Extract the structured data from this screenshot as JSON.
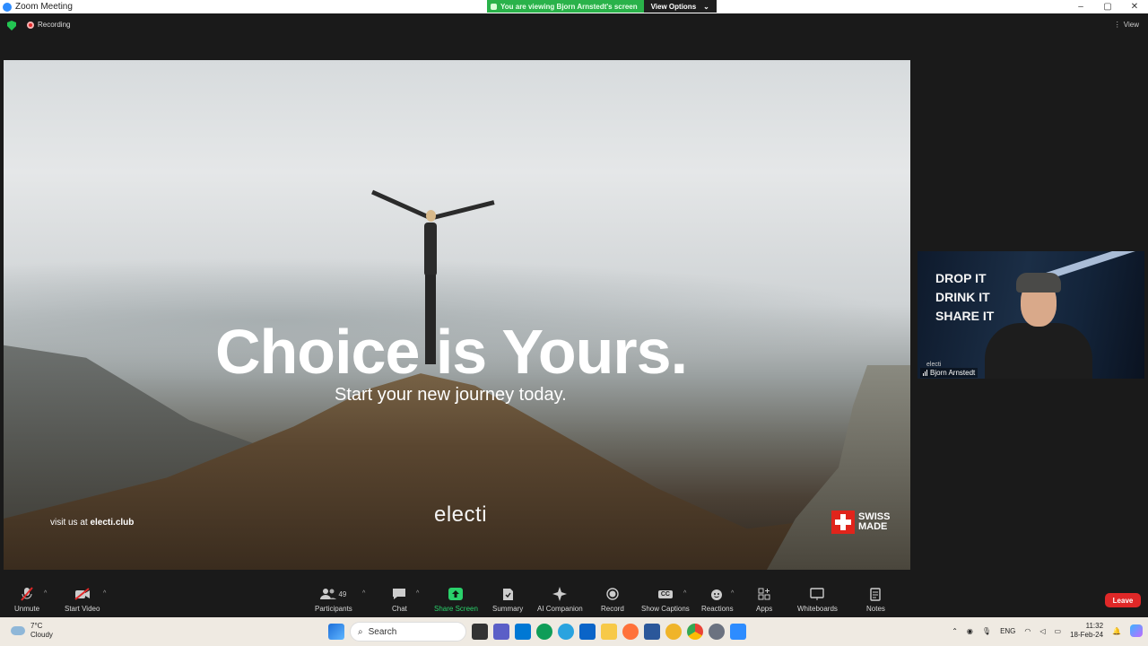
{
  "window": {
    "title": "Zoom Meeting",
    "controls": [
      "–",
      "▢",
      "✕"
    ]
  },
  "banner": {
    "viewing_text": "You are viewing Bjorn Arnstedt's screen",
    "view_options_label": "View Options",
    "view_options_caret": "⌄"
  },
  "status": {
    "recording_label": "Recording",
    "view_label": "View"
  },
  "shared_screen": {
    "headline": "Choice is Yours.",
    "subline": "Start your new journey today.",
    "visit_prefix": "visit us at ",
    "visit_link": "electi.club",
    "brand": "electi",
    "badge_line1": "SWISS",
    "badge_line2": "MADE"
  },
  "video_tile": {
    "slogan": [
      "DROP IT",
      "DRINK IT",
      "SHARE IT"
    ],
    "tag": "electi",
    "participant_name": "Bjorn Arnstedt"
  },
  "toolbar": {
    "unmute": "Unmute",
    "start_video": "Start Video",
    "participants": "Participants",
    "participants_count": "49",
    "chat": "Chat",
    "share_screen": "Share Screen",
    "summary": "Summary",
    "ai_companion": "AI Companion",
    "record": "Record",
    "show_captions": "Show Captions",
    "captions_icon_text": "CC",
    "reactions": "Reactions",
    "apps": "Apps",
    "whiteboards": "Whiteboards",
    "notes": "Notes",
    "leave": "Leave"
  },
  "taskbar": {
    "temperature": "7°C",
    "condition": "Cloudy",
    "search_label": "Search",
    "language": "ENG",
    "time": "11:32",
    "date": "18-Feb-24"
  },
  "colors": {
    "accent_green": "#2ad16b",
    "leave_red": "#e02828",
    "banner_green": "#2ab24a"
  }
}
